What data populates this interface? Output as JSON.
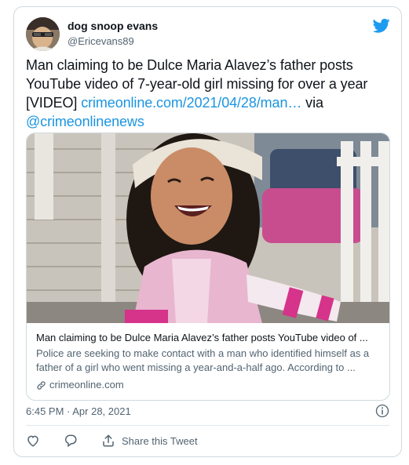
{
  "author": {
    "display_name": "dog snoop evans",
    "handle": "@Ericevans89"
  },
  "tweet": {
    "text_plain": "Man claiming to be Dulce Maria Alavez’s father posts YouTube video of 7-year-old girl missing for over a year [VIDEO] ",
    "link_text": "crimeonline.com/2021/04/28/man…",
    "via_text": " via ",
    "mention_text": "@crimeonlinenews",
    "timestamp": "6:45 PM · Apr 28, 2021"
  },
  "link_card": {
    "title": "Man claiming to be Dulce Maria Alavez’s father posts YouTube video of ...",
    "description": "Police are seeking to make contact with a man who identified himself as a father of a girl who went missing a year-and-a-half ago. According to ...",
    "domain": "crimeonline.com"
  },
  "actions": {
    "share_label": "Share this Tweet"
  },
  "colors": {
    "twitter_blue": "#1d9bf0",
    "link_blue": "#1b95e0",
    "muted_gray": "#536471",
    "border": "#cfd9de"
  },
  "icons": [
    "twitter-bird-icon",
    "info-icon",
    "heart-icon",
    "reply-icon",
    "share-icon",
    "link-icon"
  ]
}
